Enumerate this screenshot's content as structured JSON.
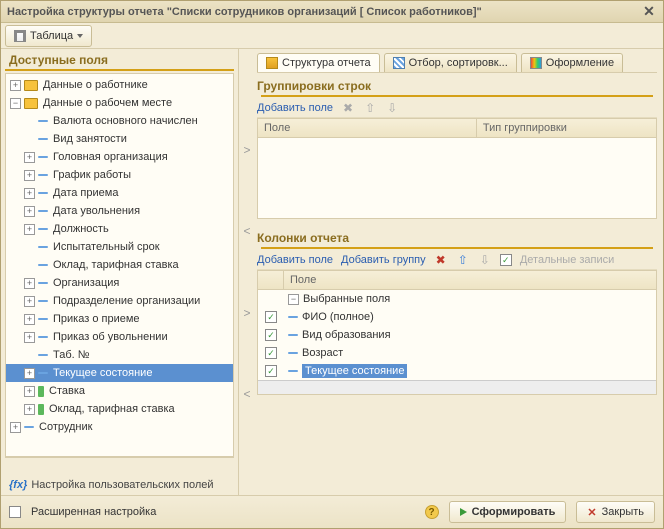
{
  "title": "Настройка структуры отчета \"Списки сотрудников организаций [ Список работников]\"",
  "toolbar": {
    "table": "Таблица"
  },
  "left": {
    "heading": "Доступные поля",
    "root1": "Данные о работнике",
    "root2": "Данные о рабочем месте",
    "items": [
      "Валюта основного начислен",
      "Вид занятости",
      "Головная организация",
      "График работы",
      "Дата приема",
      "Дата увольнения",
      "Должность",
      "Испытательный срок",
      "Оклад, тарифная ставка",
      "Организация",
      "Подразделение организации",
      "Приказ о приеме",
      "Приказ об увольнении",
      "Таб. №",
      "Текущее состояние",
      "Ставка",
      "Оклад, тарифная ставка"
    ],
    "root3": "Сотрудник",
    "userfields": "Настройка пользовательских полей"
  },
  "tabs": {
    "t1": "Структура отчета",
    "t2": "Отбор, сортировк...",
    "t3": "Оформление"
  },
  "rowgroups": {
    "title": "Группировки строк",
    "add": "Добавить поле",
    "col1": "Поле",
    "col2": "Тип группировки"
  },
  "columns": {
    "title": "Колонки отчета",
    "add": "Добавить поле",
    "addgroup": "Добавить группу",
    "details": "Детальные записи",
    "col1": "Поле",
    "root": "Выбранные поля",
    "items": [
      "ФИО (полное)",
      "Вид образования",
      "Возраст",
      "Текущее состояние"
    ]
  },
  "footer": {
    "extended": "Расширенная настройка",
    "generate": "Сформировать",
    "close": "Закрыть"
  }
}
